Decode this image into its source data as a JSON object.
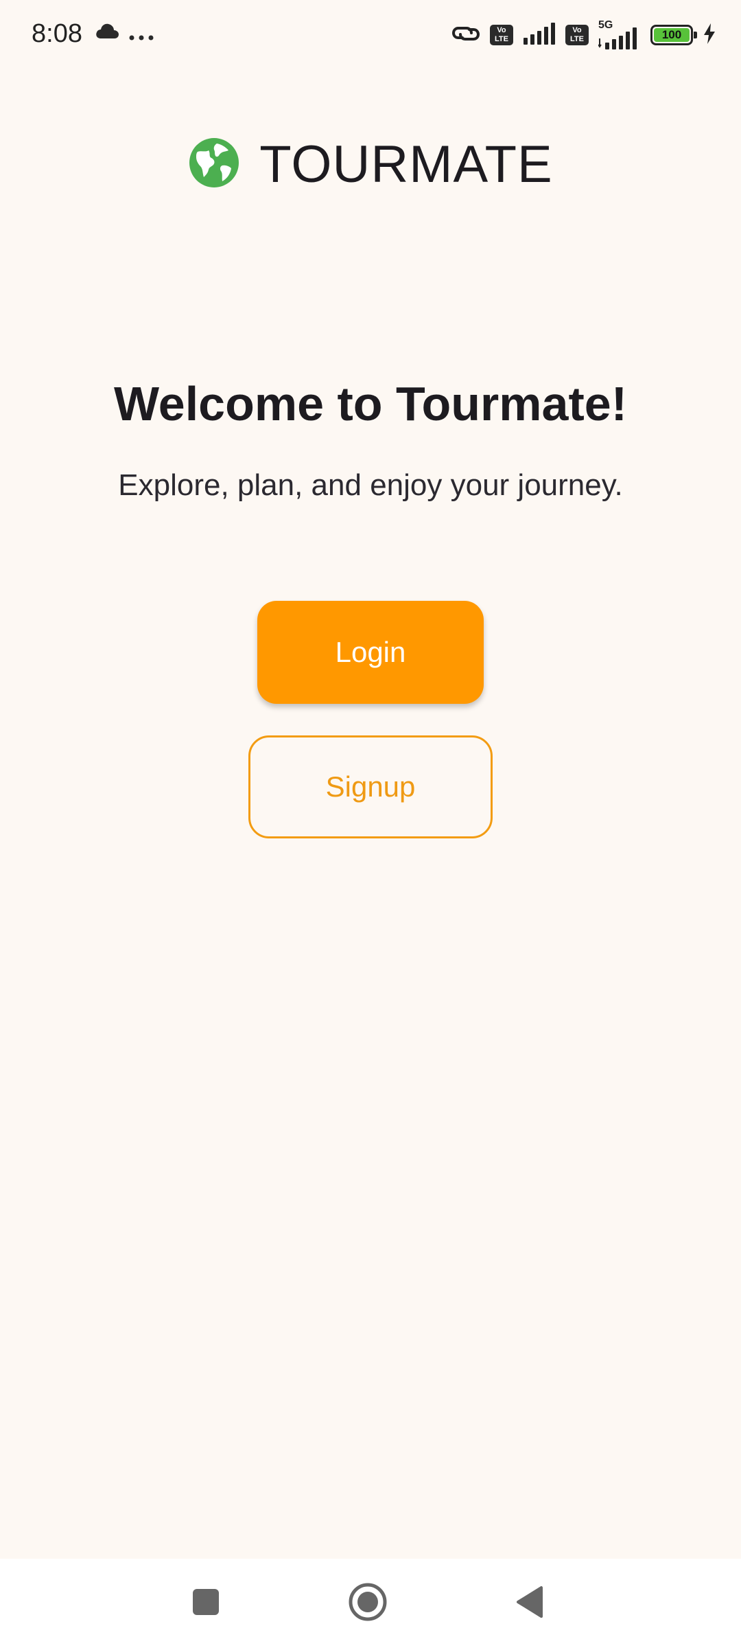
{
  "status_bar": {
    "time": "8:08",
    "icons": [
      "cloud-icon",
      "more-dots-icon",
      "link-icon",
      "volte-icon",
      "signal-icon",
      "volte-icon",
      "5g-signal-icon",
      "battery-icon",
      "charging-icon"
    ],
    "volte_label_1": "Vo",
    "volte_label_2": "LTE",
    "network_label": "5G",
    "battery_level": "100"
  },
  "brand": {
    "logo_icon": "globe-icon",
    "title": "TOURMATE",
    "logo_color": "#4caf50"
  },
  "welcome": {
    "heading": "Welcome to Tourmate!",
    "tagline": "Explore, plan, and enjoy your journey."
  },
  "actions": {
    "login_label": "Login",
    "signup_label": "Signup",
    "accent_color": "#ff9800"
  },
  "nav_bar": {
    "buttons": [
      "recents-square-icon",
      "home-circle-icon",
      "back-triangle-icon"
    ]
  }
}
